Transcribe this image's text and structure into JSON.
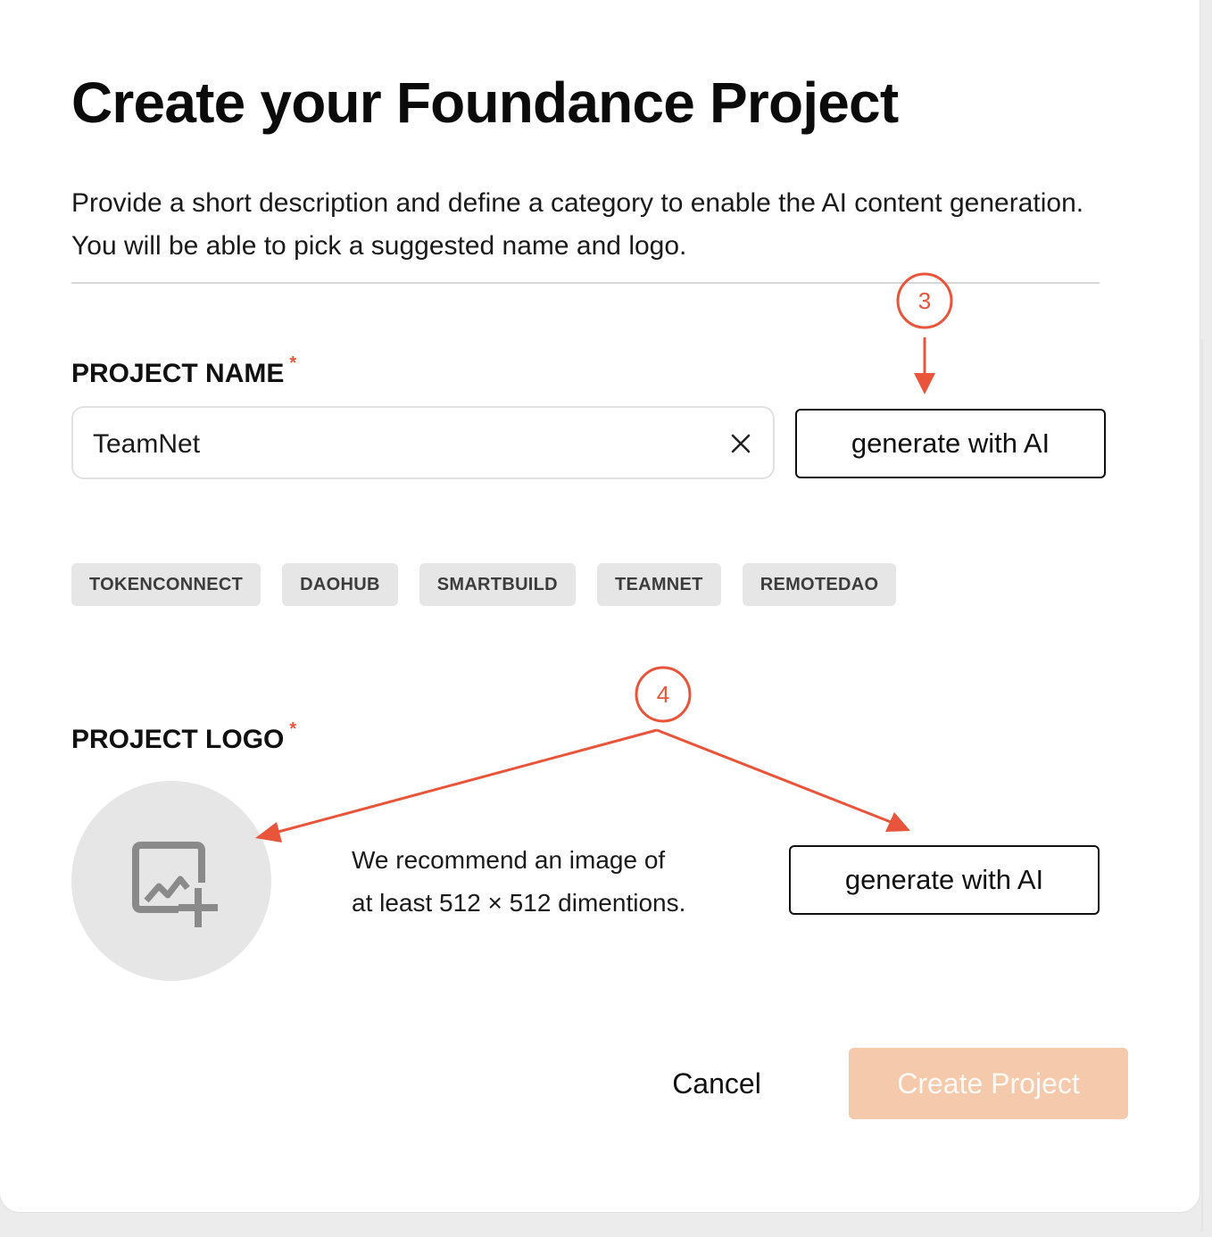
{
  "modal": {
    "title": "Create your Foundance Project",
    "description": "Provide a short description and define a category to enable the AI content generation. You will be able to pick a suggested name and logo."
  },
  "project_name": {
    "label": "PROJECT NAME",
    "required_mark": "*",
    "value": "TeamNet",
    "generate_label": "generate with AI",
    "suggestions": [
      "TOKENCONNECT",
      "DAOHUB",
      "SMARTBUILD",
      "TEAMNET",
      "REMOTEDAO"
    ]
  },
  "project_logo": {
    "label": "PROJECT LOGO",
    "required_mark": "*",
    "hint_line1": "We recommend an image of",
    "hint_line2": "at least 512 × 512 dimentions.",
    "generate_label": "generate with AI"
  },
  "actions": {
    "cancel_label": "Cancel",
    "create_label": "Create Project",
    "create_enabled": false
  },
  "annotations": {
    "step3": "3",
    "step4": "4",
    "color": "#e8553a"
  },
  "colors": {
    "accent_disabled": "#f5c9ab",
    "chip_bg": "#e6e6e6",
    "required": "#e8553a"
  },
  "icons": {
    "clear": "close-icon",
    "logo_upload": "add-image-icon"
  }
}
